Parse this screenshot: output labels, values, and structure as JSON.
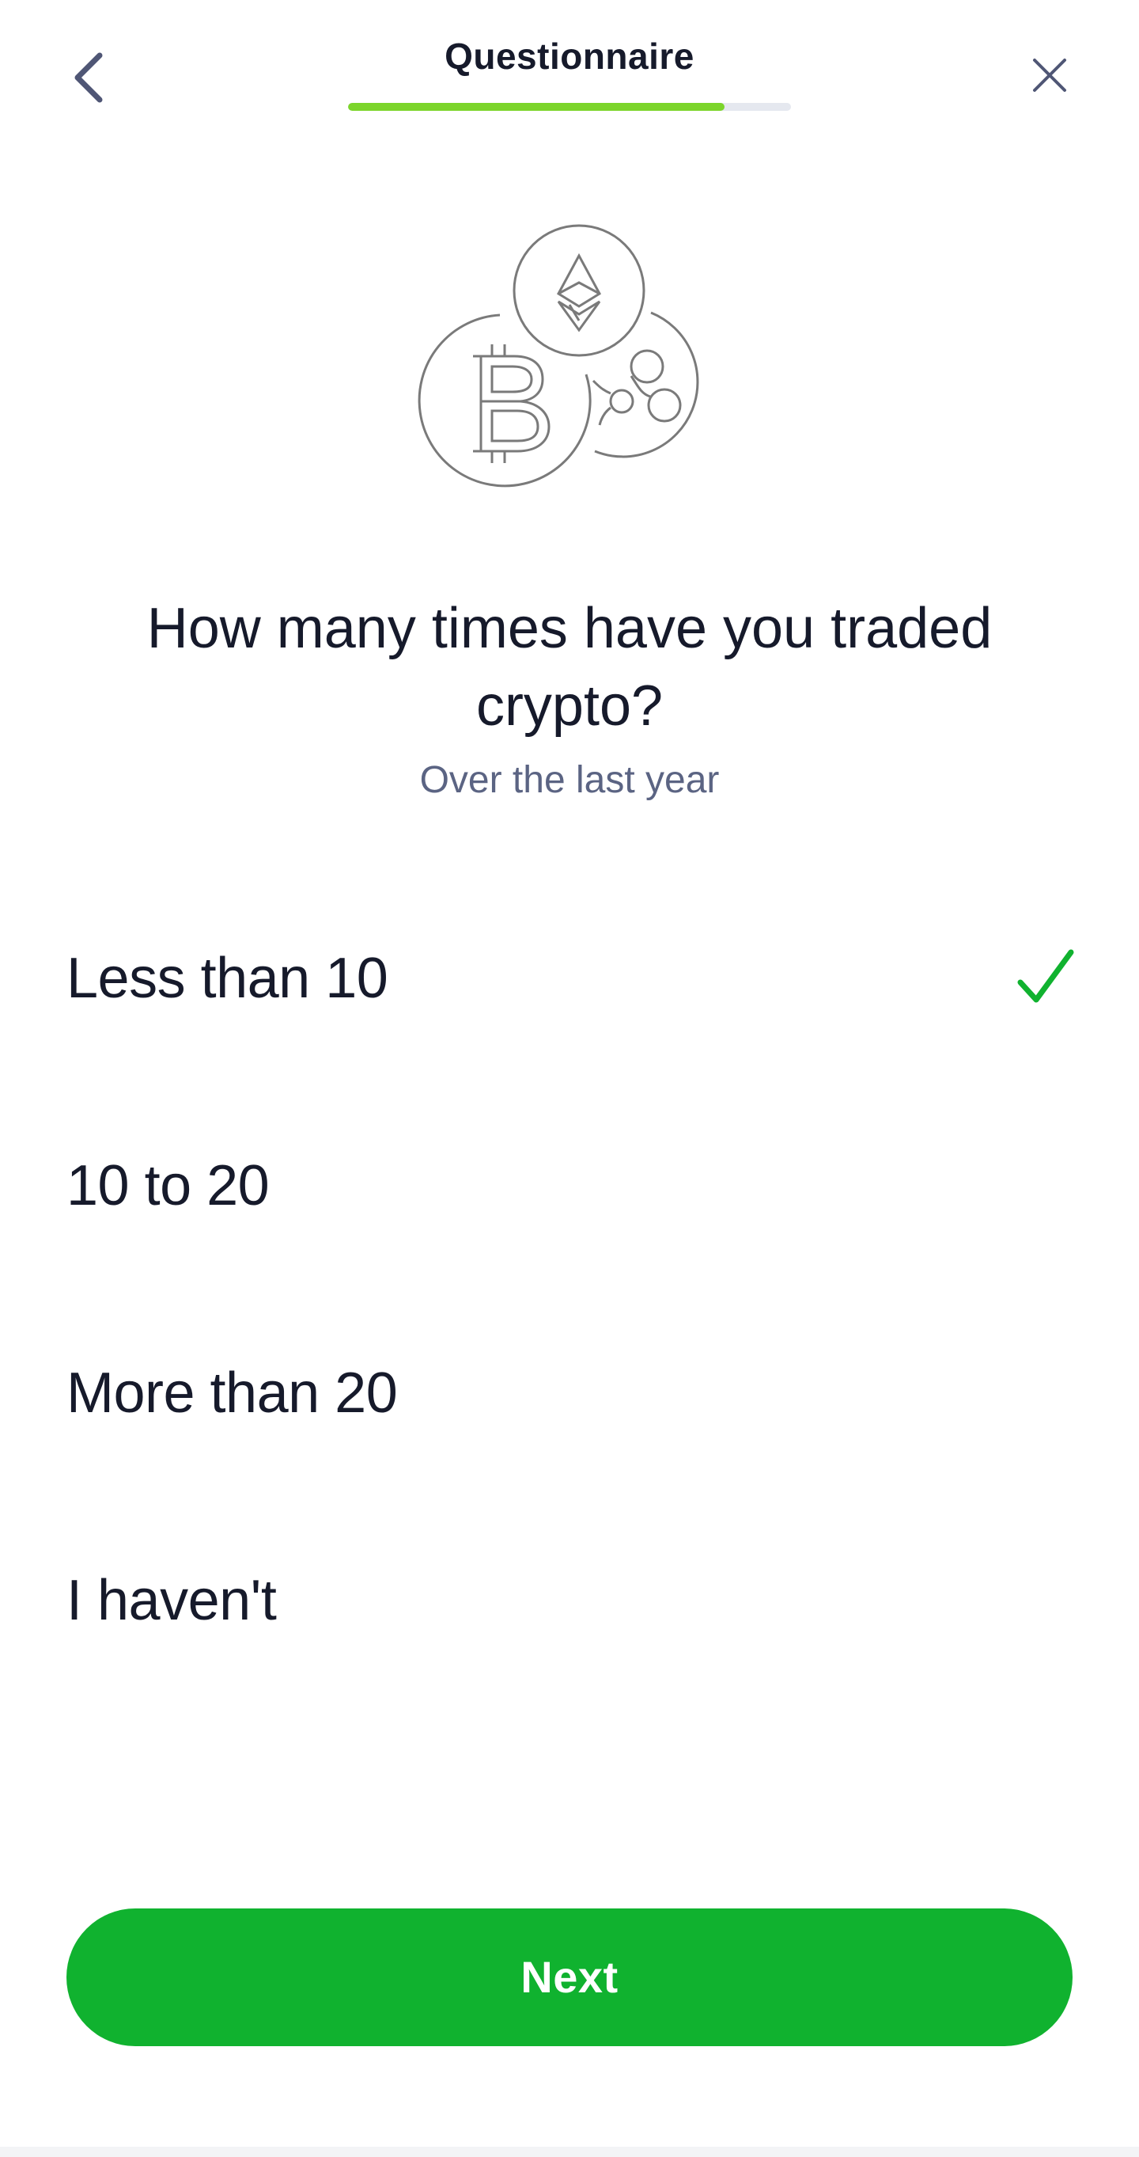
{
  "header": {
    "title": "Questionnaire",
    "back_icon": "chevron-left-icon",
    "close_icon": "close-icon",
    "progress_fraction": 0.85
  },
  "illustration": {
    "icons": [
      "ethereum-coin-icon",
      "bitcoin-coin-icon",
      "ripple-coin-icon"
    ]
  },
  "question": {
    "text": "How many times have you traded crypto?",
    "subtitle": "Over the last year"
  },
  "options": [
    {
      "label": "Less than 10",
      "selected": true
    },
    {
      "label": "10 to 20",
      "selected": false
    },
    {
      "label": "More than 20",
      "selected": false
    },
    {
      "label": "I haven't",
      "selected": false
    }
  ],
  "actions": {
    "next_label": "Next"
  },
  "colors": {
    "accent_green": "#10b22f",
    "progress_green": "#7cd52b",
    "text_dark": "#161a2b",
    "text_muted": "#5b6483",
    "icon_grey": "#7a7a7a"
  }
}
